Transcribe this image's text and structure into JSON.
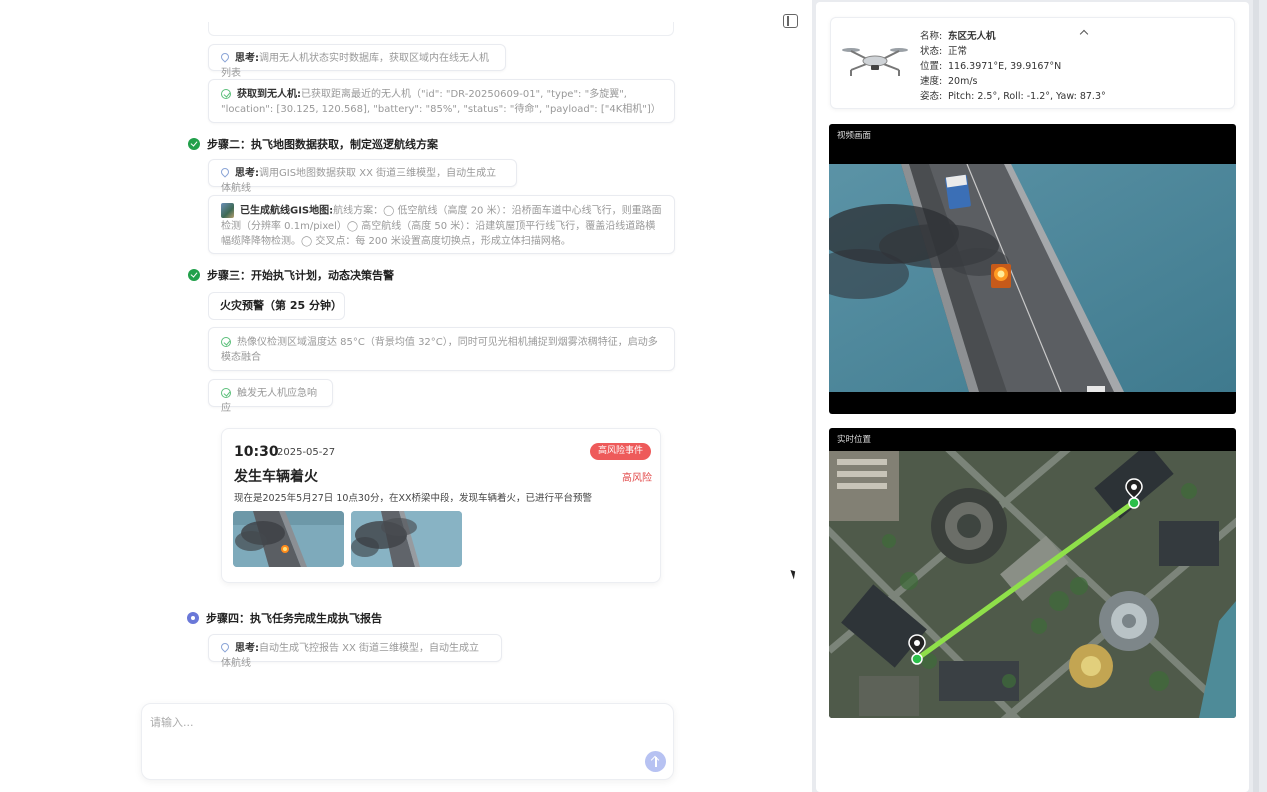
{
  "chat": {
    "think1": {
      "label": "思考:",
      "text": "调用无人机状态实时数据库，获取区域内在线无人机列表"
    },
    "result1": {
      "label": "获取到无人机:",
      "text": "已获取距离最近的无人机（\"id\": \"DR-20250609-01\", \"type\": \"多旋翼\", \"location\": [30.125, 120.568], \"battery\": \"85%\", \"status\": \"待命\", \"payload\": [\"4K相机\"]）"
    },
    "step2": {
      "title": "步骤二：执飞地图数据获取，制定巡逻航线方案"
    },
    "think2": {
      "label": "思考:",
      "text": "调用GIS地图数据获取 XX 街道三维模型，自动生成立体航线"
    },
    "result2": {
      "label": "已生成航线GIS地图:",
      "text": "航线方案：◯ 低空航线（高度 20 米）：沿桥面车道中心线飞行，则重路面检测（分辨率 0.1m/pixel）◯ 高空航线（高度 50 米）：沿建筑屋顶平行线飞行，覆盖沿线道路横幅缆降降物检测。◯ 交叉点：每 200 米设置高度切换点，形成立体扫描网格。"
    },
    "step3": {
      "title": "步骤三：开始执飞计划，动态决策告警"
    },
    "fire_warning": "火灾预警（第 25 分钟）",
    "result3": {
      "text": "热像仪检测区域温度达 85°C（背景均值 32°C），同时可见光相机捕捉到烟雾浓稠特征，启动多模态融合"
    },
    "result4": {
      "text": "触发无人机应急响应"
    },
    "event": {
      "time": "10:30",
      "date": "2025-05-27",
      "badge": "高风险事件",
      "risk": "高风险",
      "title": "发生车辆着火",
      "desc": "现在是2025年5月27日 10点30分，在XX桥梁中段，发现车辆着火，已进行平台预警"
    },
    "step4": {
      "title": "步骤四：执飞任务完成生成执飞报告"
    },
    "think4": {
      "label": "思考:",
      "text": "自动生成飞控报告 XX 街道三维模型，自动生成立体航线"
    }
  },
  "input": {
    "placeholder": "请输入..."
  },
  "drone": {
    "name_label": "名称:",
    "name": "东区无人机",
    "status_label": "状态:",
    "status": "正常",
    "position_label": "位置:",
    "position": "116.3971°E, 39.9167°N",
    "speed_label": "速度:",
    "speed": "20m/s",
    "attitude_label": "姿态:",
    "attitude": "Pitch: 2.5°, Roll: -1.2°, Yaw: 87.3°"
  },
  "video": {
    "label": "视频画面"
  },
  "map": {
    "label": "实时位置",
    "route_color": "#8fe04a"
  },
  "colors": {
    "done": "#22a04b",
    "active": "#6a78d8",
    "danger": "#ee5a5a",
    "send": "#b7c2f2"
  }
}
